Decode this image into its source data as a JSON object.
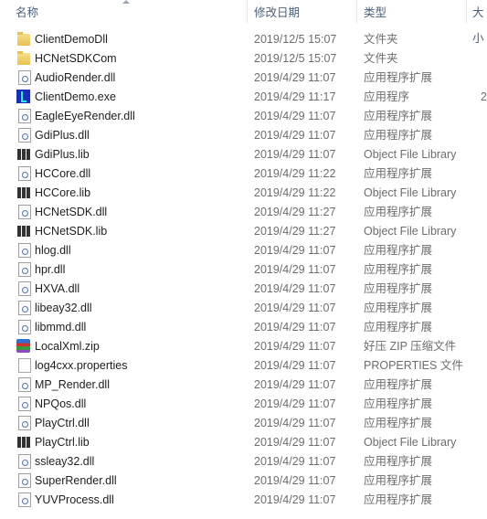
{
  "header": {
    "name": "名称",
    "date": "修改日期",
    "type": "类型",
    "size": "大小"
  },
  "files": [
    {
      "name": "ClientDemoDll",
      "date": "2019/12/5 15:07",
      "type": "文件夹",
      "icon": "folder",
      "size": ""
    },
    {
      "name": "HCNetSDKCom",
      "date": "2019/12/5 15:07",
      "type": "文件夹",
      "icon": "folder",
      "size": ""
    },
    {
      "name": "AudioRender.dll",
      "date": "2019/4/29 11:07",
      "type": "应用程序扩展",
      "icon": "dll",
      "size": ""
    },
    {
      "name": "ClientDemo.exe",
      "date": "2019/4/29 11:17",
      "type": "应用程序",
      "icon": "exe",
      "size": "2"
    },
    {
      "name": "EagleEyeRender.dll",
      "date": "2019/4/29 11:07",
      "type": "应用程序扩展",
      "icon": "dll",
      "size": ""
    },
    {
      "name": "GdiPlus.dll",
      "date": "2019/4/29 11:07",
      "type": "应用程序扩展",
      "icon": "dll",
      "size": ""
    },
    {
      "name": "GdiPlus.lib",
      "date": "2019/4/29 11:07",
      "type": "Object File Library",
      "icon": "lib",
      "size": ""
    },
    {
      "name": "HCCore.dll",
      "date": "2019/4/29 11:22",
      "type": "应用程序扩展",
      "icon": "dll",
      "size": ""
    },
    {
      "name": "HCCore.lib",
      "date": "2019/4/29 11:22",
      "type": "Object File Library",
      "icon": "lib",
      "size": ""
    },
    {
      "name": "HCNetSDK.dll",
      "date": "2019/4/29 11:27",
      "type": "应用程序扩展",
      "icon": "dll",
      "size": ""
    },
    {
      "name": "HCNetSDK.lib",
      "date": "2019/4/29 11:27",
      "type": "Object File Library",
      "icon": "lib",
      "size": ""
    },
    {
      "name": "hlog.dll",
      "date": "2019/4/29 11:07",
      "type": "应用程序扩展",
      "icon": "dll",
      "size": ""
    },
    {
      "name": "hpr.dll",
      "date": "2019/4/29 11:07",
      "type": "应用程序扩展",
      "icon": "dll",
      "size": ""
    },
    {
      "name": "HXVA.dll",
      "date": "2019/4/29 11:07",
      "type": "应用程序扩展",
      "icon": "dll",
      "size": ""
    },
    {
      "name": "libeay32.dll",
      "date": "2019/4/29 11:07",
      "type": "应用程序扩展",
      "icon": "dll",
      "size": ""
    },
    {
      "name": "libmmd.dll",
      "date": "2019/4/29 11:07",
      "type": "应用程序扩展",
      "icon": "dll",
      "size": ""
    },
    {
      "name": "LocalXml.zip",
      "date": "2019/4/29 11:07",
      "type": "好压 ZIP 压缩文件",
      "icon": "zip",
      "size": ""
    },
    {
      "name": "log4cxx.properties",
      "date": "2019/4/29 11:07",
      "type": "PROPERTIES 文件",
      "icon": "props",
      "size": ""
    },
    {
      "name": "MP_Render.dll",
      "date": "2019/4/29 11:07",
      "type": "应用程序扩展",
      "icon": "dll",
      "size": ""
    },
    {
      "name": "NPQos.dll",
      "date": "2019/4/29 11:07",
      "type": "应用程序扩展",
      "icon": "dll",
      "size": ""
    },
    {
      "name": "PlayCtrl.dll",
      "date": "2019/4/29 11:07",
      "type": "应用程序扩展",
      "icon": "dll",
      "size": ""
    },
    {
      "name": "PlayCtrl.lib",
      "date": "2019/4/29 11:07",
      "type": "Object File Library",
      "icon": "lib",
      "size": ""
    },
    {
      "name": "ssleay32.dll",
      "date": "2019/4/29 11:07",
      "type": "应用程序扩展",
      "icon": "dll",
      "size": ""
    },
    {
      "name": "SuperRender.dll",
      "date": "2019/4/29 11:07",
      "type": "应用程序扩展",
      "icon": "dll",
      "size": ""
    },
    {
      "name": "YUVProcess.dll",
      "date": "2019/4/29 11:07",
      "type": "应用程序扩展",
      "icon": "dll",
      "size": ""
    }
  ]
}
